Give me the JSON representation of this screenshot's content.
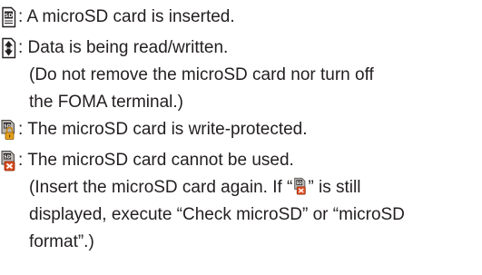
{
  "items": [
    {
      "icon": "sd-card-icon",
      "text": ": A microSD card is inserted."
    },
    {
      "icon": "data-transfer-icon",
      "text": ": Data is being read/written.",
      "note_lines": [
        "(Do not remove the microSD card nor turn off",
        "the FOMA terminal.)"
      ]
    },
    {
      "icon": "sd-write-protect-icon",
      "text": ": The microSD card is write-protected."
    },
    {
      "icon": "sd-unusable-icon",
      "text": ": The microSD card cannot be used.",
      "note_line_1_before": "(Insert the microSD card again. If “",
      "note_line_1_after": "” is still",
      "note_lines_rest": [
        "displayed, execute “Check microSD” or “microSD",
        "format”.)"
      ]
    }
  ]
}
